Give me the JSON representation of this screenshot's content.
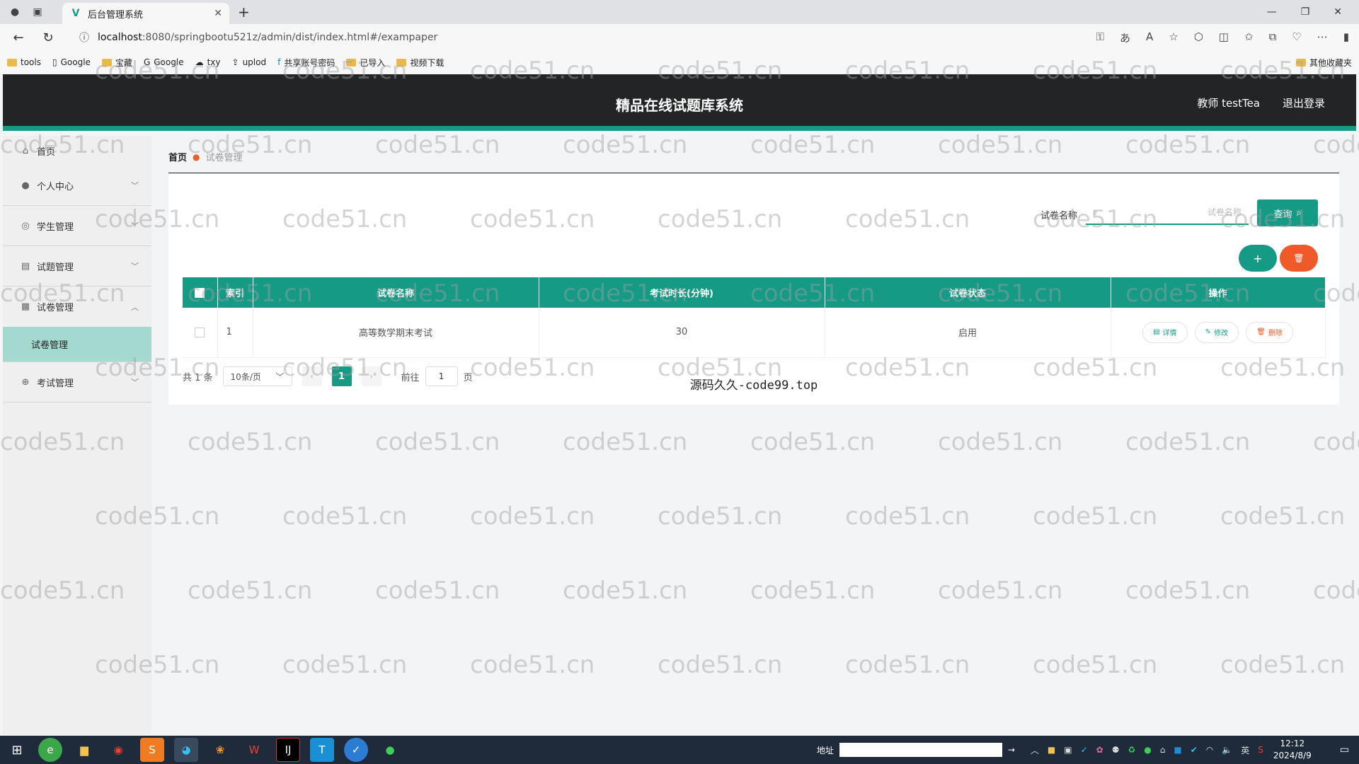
{
  "browser": {
    "tab_title": "后台管理系统",
    "url_host": "localhost",
    "url_rest": ":8080/springbootu521z/admin/dist/index.html#/exampaper",
    "bookmarks": [
      "tools",
      "Google",
      "宝藏",
      "Google",
      "txy",
      "uplod",
      "共享账号密码",
      "已导入",
      "视频下载"
    ],
    "other_bookmarks": "其他收藏夹"
  },
  "header": {
    "title": "精品在线试题库系统",
    "user": "教师 testTea",
    "logout": "退出登录"
  },
  "sidebar": {
    "items": [
      {
        "label": "首页",
        "icon": "home-icon"
      },
      {
        "label": "个人中心",
        "icon": "user-icon"
      },
      {
        "label": "学生管理",
        "icon": "student-icon"
      },
      {
        "label": "试题管理",
        "icon": "question-bank-icon"
      },
      {
        "label": "试卷管理",
        "icon": "grid-icon"
      },
      {
        "label": "考试管理",
        "icon": "exam-icon"
      }
    ],
    "active_sub": "试卷管理"
  },
  "breadcrumb": {
    "home": "首页",
    "current": "试卷管理"
  },
  "search": {
    "label": "试卷名称",
    "placeholder": "试卷名称",
    "button": "查询"
  },
  "actions": {
    "add": "+",
    "delete": "🗑"
  },
  "table": {
    "headers": [
      "索引",
      "试卷名称",
      "考试时长(分钟)",
      "试卷状态",
      "操作"
    ],
    "rows": [
      {
        "index": "1",
        "name": "高等数学期末考试",
        "duration": "30",
        "status": "启用"
      }
    ],
    "ops": [
      "详情",
      "修改",
      "删除"
    ]
  },
  "pager": {
    "total": "共 1 条",
    "page_size": "10条/页",
    "current": "1",
    "goto_label": "前往",
    "goto_value": "1",
    "page_unit": "页"
  },
  "caption": "源码久久-code99.top",
  "watermark": "code51.cn",
  "taskbar": {
    "address_label": "地址",
    "ime": "英",
    "time": "12:12",
    "date": "2024/8/9"
  },
  "colors": {
    "accent": "#159a86",
    "danger": "#f05a28",
    "header_bg": "#222425",
    "active_sub_bg": "#a4d9d0"
  }
}
